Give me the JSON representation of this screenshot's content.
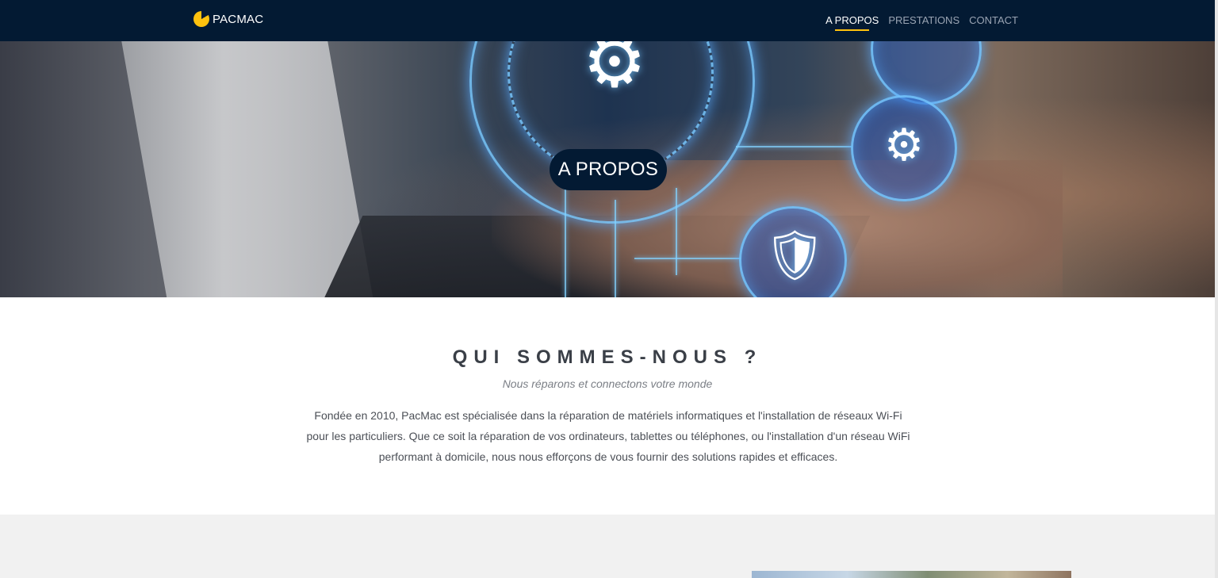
{
  "navbar": {
    "brand": "PACMAC",
    "links": [
      {
        "label": "A PROPOS",
        "active": true
      },
      {
        "label": "PRESTATIONS",
        "active": false
      },
      {
        "label": "CONTACT",
        "active": false
      }
    ],
    "accent_color": "#ffc20e",
    "background_color": "#031a33"
  },
  "hero": {
    "title": "A PROPOS",
    "icons": [
      "gear-check-icon",
      "chip-icon",
      "shield-check-icon"
    ]
  },
  "about": {
    "title": "QUI SOMMES-NOUS ?",
    "subtitle": "Nous réparons et connectons votre monde",
    "text": "Fondée en 2010, PacMac est spécialisée dans la réparation de matériels informatiques et l'installation de réseaux Wi-Fi pour les particuliers. Que ce soit la réparation de vos ordinateurs, tablettes ou téléphones, ou l'installation d'un réseau WiFi performant à domicile, nous nous efforçons de vous fournir des solutions rapides et efficaces."
  }
}
